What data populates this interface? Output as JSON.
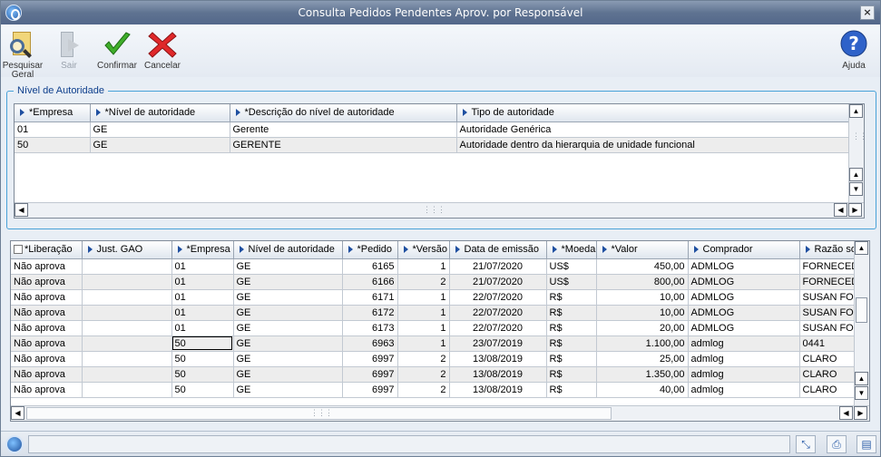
{
  "window": {
    "title": "Consulta Pedidos Pendentes Aprov. por Responsável"
  },
  "toolbar": {
    "search_label_1": "Pesquisar",
    "search_label_2": "Geral",
    "exit_label": "Sair",
    "confirm_label": "Confirmar",
    "cancel_label": "Cancelar",
    "help_label": "Ajuda"
  },
  "authority_group": {
    "title": "Nível de Autoridade",
    "columns": [
      "*Empresa",
      "*Nível de autoridade",
      "*Descrição do nível de autoridade",
      "Tipo de autoridade"
    ],
    "rows": [
      [
        "01",
        "GE",
        "Gerente",
        "Autoridade Genérica"
      ],
      [
        "50",
        "GE",
        "GERENTE",
        "Autoridade dentro da hierarquia de unidade funcional"
      ]
    ]
  },
  "orders_grid": {
    "columns": [
      "*Liberação",
      "Just. GAO",
      "*Empresa",
      "Nível de autoridade",
      "*Pedido",
      "*Versão",
      "Data de emissão",
      "*Moeda",
      "*Valor",
      "Comprador",
      "Razão so"
    ],
    "rows": [
      [
        "Não aprova",
        "",
        "01",
        "GE",
        "6165",
        "1",
        "21/07/2020",
        "US$",
        "450,00",
        "ADMLOG",
        "FORNECEDO"
      ],
      [
        "Não aprova",
        "",
        "01",
        "GE",
        "6166",
        "2",
        "21/07/2020",
        "US$",
        "800,00",
        "ADMLOG",
        "FORNECEDO"
      ],
      [
        "Não aprova",
        "",
        "01",
        "GE",
        "6171",
        "1",
        "22/07/2020",
        "R$",
        "10,00",
        "ADMLOG",
        "SUSAN FOR"
      ],
      [
        "Não aprova",
        "",
        "01",
        "GE",
        "6172",
        "1",
        "22/07/2020",
        "R$",
        "10,00",
        "ADMLOG",
        "SUSAN FOR"
      ],
      [
        "Não aprova",
        "",
        "01",
        "GE",
        "6173",
        "1",
        "22/07/2020",
        "R$",
        "20,00",
        "ADMLOG",
        "SUSAN FOR"
      ],
      [
        "Não aprova",
        "",
        "50",
        "GE",
        "6963",
        "1",
        "23/07/2019",
        "R$",
        "1.100,00",
        "admlog",
        "0441"
      ],
      [
        "Não aprova",
        "",
        "50",
        "GE",
        "6997",
        "2",
        "13/08/2019",
        "R$",
        "25,00",
        "admlog",
        "CLARO"
      ],
      [
        "Não aprova",
        "",
        "50",
        "GE",
        "6997",
        "2",
        "13/08/2019",
        "R$",
        "1.350,00",
        "admlog",
        "CLARO"
      ],
      [
        "Não aprova",
        "",
        "50",
        "GE",
        "6997",
        "2",
        "13/08/2019",
        "R$",
        "40,00",
        "admlog",
        "CLARO"
      ]
    ]
  },
  "colors": {
    "title_bar": "#5f7391",
    "group_border": "#49a2d8",
    "header_triangle": "#1f4fa0"
  }
}
